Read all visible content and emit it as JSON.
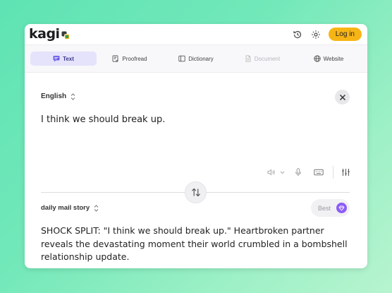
{
  "app": {
    "logo_text": "kagi",
    "login_label": "Log in"
  },
  "tabs": [
    {
      "label": "Text",
      "icon": "message-icon",
      "state": "active"
    },
    {
      "label": "Proofread",
      "icon": "proofread-icon",
      "state": "normal"
    },
    {
      "label": "Dictionary",
      "icon": "book-icon",
      "state": "normal"
    },
    {
      "label": "Document",
      "icon": "document-icon",
      "state": "disabled"
    },
    {
      "label": "Website",
      "icon": "globe-icon",
      "state": "normal"
    }
  ],
  "source": {
    "language": "English",
    "text": "I think we should break up."
  },
  "target": {
    "language": "daily mail story",
    "quality_label": "Best",
    "text": "SHOCK SPLIT: \"I think we should break up.\" Heartbroken partner reveals the devastating moment their world crumbled in a bombshell relationship update."
  },
  "colors": {
    "accent": "#f7b515",
    "tab_active_bg": "#e5e3fb",
    "gem": "#8b5cf6"
  }
}
